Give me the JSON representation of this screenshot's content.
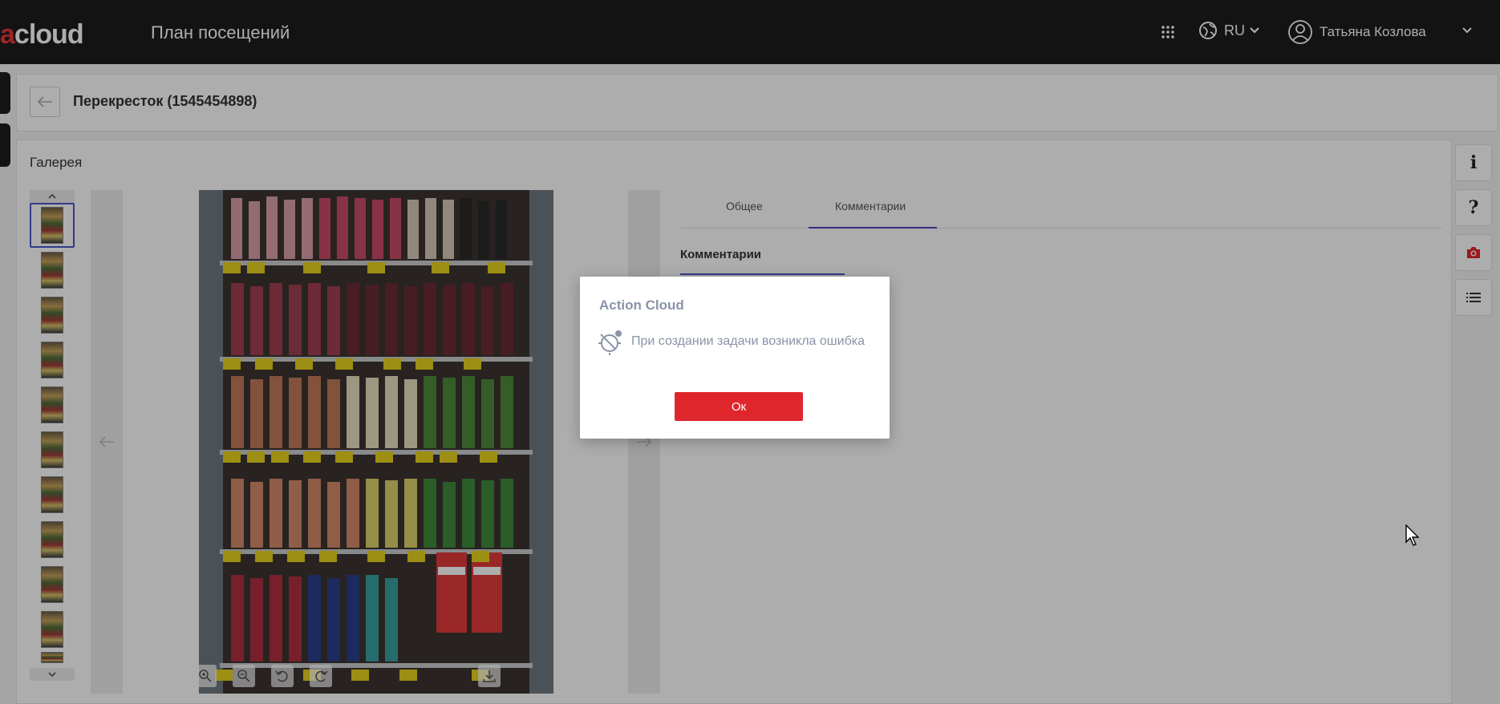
{
  "topbar": {
    "logo_accent": "a",
    "logo_text": "cloud",
    "title": "План посещений",
    "language": "RU",
    "user_name": "Татьяна Козлова",
    "icons": [
      "apps-grid-icon",
      "globe-icon",
      "chevron-down-icon",
      "user-avatar-icon",
      "chevron-down-icon"
    ]
  },
  "header": {
    "store_title": "Перекресток (1545454898)"
  },
  "gallery": {
    "title": "Галерея",
    "thumbnail_count": 11,
    "selected_index": 0
  },
  "tabs": [
    {
      "label": "Общее",
      "active": false
    },
    {
      "label": "Комментарии",
      "active": true
    }
  ],
  "comments": {
    "label": "Комментарии"
  },
  "rail": [
    {
      "name": "info-icon",
      "glyph": "i"
    },
    {
      "name": "help-icon",
      "glyph": "?"
    },
    {
      "name": "camera-icon",
      "glyph": ""
    },
    {
      "name": "list-icon",
      "glyph": ""
    }
  ],
  "dialog": {
    "title": "Action Cloud",
    "message": "При создании задачи возникла ошибка",
    "ok_label": "Ок"
  },
  "colors": {
    "topbar_bg": "#1d1d1d",
    "accent_red": "#e0262d",
    "tab_underline": "#5b3db8",
    "selection_blue": "#4a58c8",
    "dialog_text": "#8a93a8"
  }
}
